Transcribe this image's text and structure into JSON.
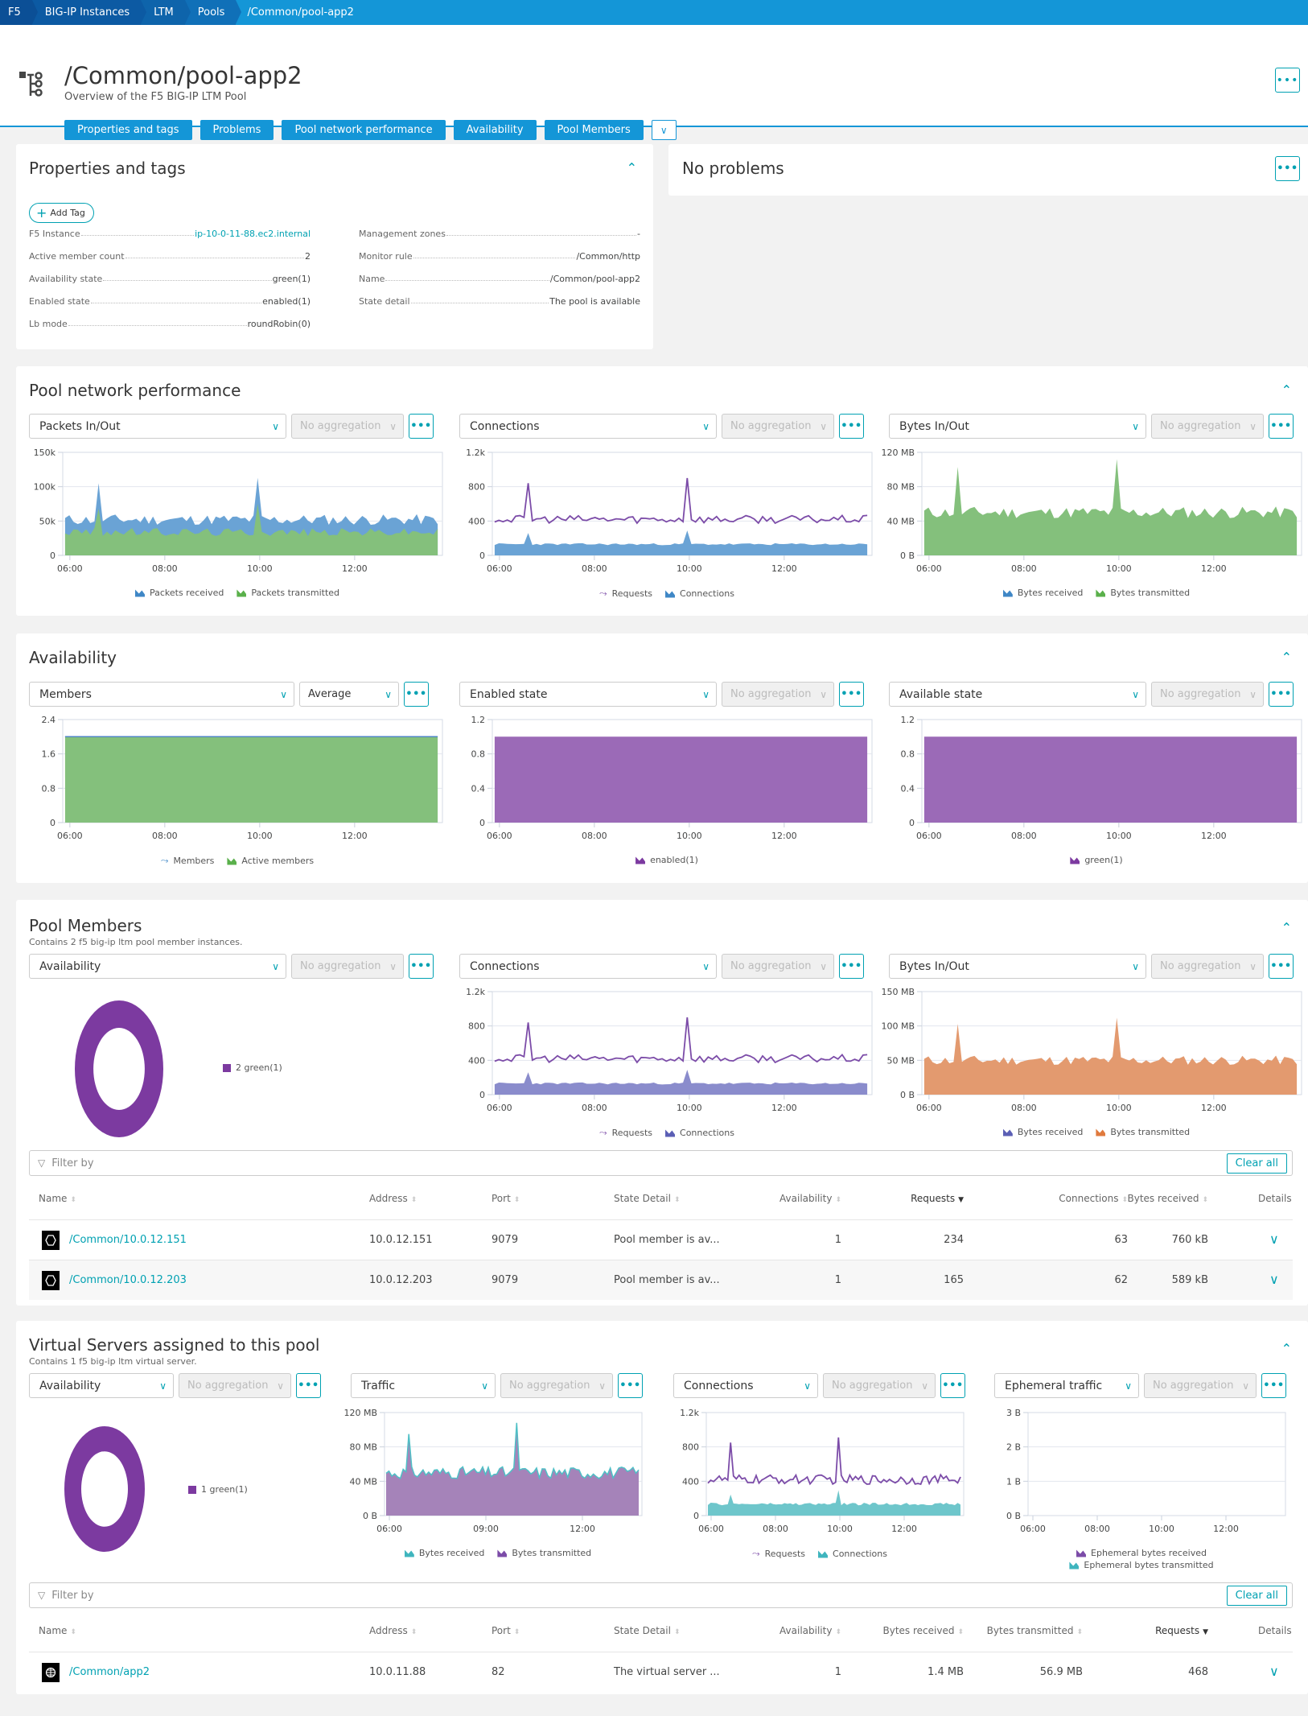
{
  "breadcrumb": [
    "F5",
    "BIG-IP Instances",
    "LTM",
    "Pools",
    "/Common/pool-app2"
  ],
  "header": {
    "title": "/Common/pool-app2",
    "subtitle": "Overview of the F5 BIG-IP LTM Pool",
    "nav": [
      "Properties and tags",
      "Problems",
      "Pool network performance",
      "Availability",
      "Pool Members"
    ],
    "more_icon": "chevron-down-icon",
    "menu_icon": "ellipsis-icon"
  },
  "properties": {
    "title": "Properties and tags",
    "add_tag": "Add Tag",
    "left": [
      {
        "k": "F5 Instance",
        "v": "ip-10-0-11-88.ec2.internal",
        "link": true
      },
      {
        "k": "Active member count",
        "v": "2"
      },
      {
        "k": "Availability state",
        "v": "green(1)"
      },
      {
        "k": "Enabled state",
        "v": "enabled(1)"
      },
      {
        "k": "Lb mode",
        "v": "roundRobin(0)"
      }
    ],
    "right": [
      {
        "k": "Management zones",
        "v": "-"
      },
      {
        "k": "Monitor rule",
        "v": "/Common/http"
      },
      {
        "k": "Name",
        "v": "/Common/pool-app2"
      },
      {
        "k": "State detail",
        "v": "The pool is available"
      }
    ]
  },
  "problems": {
    "title": "No problems"
  },
  "common": {
    "no_aggregation": "No aggregation",
    "filter_placeholder": "Filter by",
    "clear_all": "Clear all"
  },
  "network": {
    "title": "Pool network performance",
    "selects": [
      "Packets In/Out",
      "Connections",
      "Bytes In/Out"
    ]
  },
  "availability": {
    "title": "Availability",
    "selects": [
      "Members",
      "Enabled state",
      "Available state"
    ],
    "agg0": "Average"
  },
  "members": {
    "title": "Pool Members",
    "desc": "Contains 2 f5 big-ip ltm pool member instances.",
    "selects": [
      "Availability",
      "Connections",
      "Bytes In/Out"
    ],
    "donut_legend": "2 green(1)",
    "columns": [
      "Name",
      "Address",
      "Port",
      "State Detail",
      "Availability",
      "Requests",
      "Connections",
      "Bytes received",
      "Details"
    ],
    "sorted_col": "Requests",
    "rows": [
      {
        "name": "/Common/10.0.12.151",
        "address": "10.0.12.151",
        "port": "9079",
        "state": "Pool member is av...",
        "availability": "1",
        "requests": "234",
        "connections": "63",
        "bytes": "760 kB"
      },
      {
        "name": "/Common/10.0.12.203",
        "address": "10.0.12.203",
        "port": "9079",
        "state": "Pool member is av...",
        "availability": "1",
        "requests": "165",
        "connections": "62",
        "bytes": "589 kB"
      }
    ]
  },
  "vservers": {
    "title": "Virtual Servers assigned to this pool",
    "desc": "Contains 1 f5 big-ip ltm virtual server.",
    "selects": [
      "Availability",
      "Traffic",
      "Connections",
      "Ephemeral traffic"
    ],
    "donut_legend": "1 green(1)",
    "columns": [
      "Name",
      "Address",
      "Port",
      "State Detail",
      "Availability",
      "Bytes received",
      "Bytes transmitted",
      "Requests",
      "Details"
    ],
    "sorted_col": "Requests",
    "rows": [
      {
        "name": "/Common/app2",
        "address": "10.0.11.88",
        "port": "82",
        "state": "The virtual server ...",
        "availability": "1",
        "bytes_rx": "1.4 MB",
        "bytes_tx": "56.9 MB",
        "requests": "468"
      }
    ]
  },
  "chart_data": [
    {
      "id": "net-packets",
      "type": "area",
      "yticks": [
        "0",
        "50k",
        "100k",
        "150k"
      ],
      "ylim": [
        0,
        150000
      ],
      "xticks": [
        "06:00",
        "08:00",
        "10:00",
        "12:00"
      ],
      "x_range_hours": [
        5.9,
        13.75
      ],
      "series": [
        {
          "name": "Packets received",
          "color": "#6aa3d5",
          "base": 52000,
          "jitter": 8000,
          "spikes": [
            [
              6.6,
              105000
            ],
            [
              9.95,
              113000
            ]
          ],
          "stack": true
        },
        {
          "name": "Packets transmitted",
          "color": "#84c07c",
          "base": 34000,
          "jitter": 6000,
          "spikes": [
            [
              6.6,
              68000
            ],
            [
              9.95,
              75000
            ]
          ]
        }
      ],
      "legend": [
        {
          "label": "Packets received",
          "color": "#3f87c6",
          "kind": "area"
        },
        {
          "label": "Packets transmitted",
          "color": "#5ab04b",
          "kind": "area"
        }
      ]
    },
    {
      "id": "net-conn",
      "type": "line+area",
      "yticks": [
        "0",
        "400",
        "800",
        "1.2k"
      ],
      "ylim": [
        0,
        1200
      ],
      "xticks": [
        "06:00",
        "08:00",
        "10:00",
        "12:00"
      ],
      "x_range_hours": [
        5.9,
        13.75
      ],
      "series": [
        {
          "name": "Requests",
          "color": "#7c4ca8",
          "kind": "line",
          "base": 420,
          "jitter": 45,
          "spikes": [
            [
              6.6,
              840
            ],
            [
              9.95,
              900
            ]
          ]
        },
        {
          "name": "Connections",
          "color": "#6aa3d5",
          "kind": "area",
          "base": 130,
          "jitter": 12,
          "spikes": [
            [
              6.6,
              260
            ],
            [
              9.95,
              290
            ]
          ]
        }
      ],
      "legend": [
        {
          "label": "Requests",
          "color": "#7c4ca8",
          "kind": "line"
        },
        {
          "label": "Connections",
          "color": "#3f87c6",
          "kind": "area"
        }
      ]
    },
    {
      "id": "net-bytes",
      "type": "area",
      "yticks": [
        "0 B",
        "40 MB",
        "80 MB",
        "120 MB"
      ],
      "ylim": [
        0,
        120
      ],
      "xticks": [
        "06:00",
        "08:00",
        "10:00",
        "12:00"
      ],
      "x_range_hours": [
        5.9,
        13.75
      ],
      "series": [
        {
          "name": "Bytes transmitted",
          "color": "#84c07c",
          "base": 50,
          "jitter": 7,
          "spikes": [
            [
              6.6,
              103
            ],
            [
              9.95,
              112
            ]
          ]
        }
      ],
      "legend": [
        {
          "label": "Bytes received",
          "color": "#3f87c6",
          "kind": "area"
        },
        {
          "label": "Bytes transmitted",
          "color": "#5ab04b",
          "kind": "area"
        }
      ]
    },
    {
      "id": "av-members",
      "type": "area",
      "yticks": [
        "0",
        "0.8",
        "1.6",
        "2.4"
      ],
      "ylim": [
        0,
        2.4
      ],
      "xticks": [
        "06:00",
        "08:00",
        "10:00",
        "12:00"
      ],
      "x_range_hours": [
        5.9,
        13.75
      ],
      "series": [
        {
          "name": "Active members",
          "color": "#84c07c",
          "base": 2,
          "jitter": 0,
          "spikes": [],
          "topline": "#4f86c4"
        }
      ],
      "legend": [
        {
          "label": "Members",
          "color": "#3f87c6",
          "kind": "line"
        },
        {
          "label": "Active members",
          "color": "#5ab04b",
          "kind": "area"
        }
      ]
    },
    {
      "id": "av-enabled",
      "type": "area",
      "yticks": [
        "0",
        "0.4",
        "0.8",
        "1.2"
      ],
      "ylim": [
        0,
        1.2
      ],
      "xticks": [
        "06:00",
        "08:00",
        "10:00",
        "12:00"
      ],
      "x_range_hours": [
        5.9,
        13.75
      ],
      "series": [
        {
          "name": "enabled(1)",
          "color": "#9b6ab7",
          "base": 1,
          "jitter": 0,
          "spikes": []
        }
      ],
      "legend": [
        {
          "label": "enabled(1)",
          "color": "#7c3aa0",
          "kind": "area"
        }
      ]
    },
    {
      "id": "av-available",
      "type": "area",
      "yticks": [
        "0",
        "0.4",
        "0.8",
        "1.2"
      ],
      "ylim": [
        0,
        1.2
      ],
      "xticks": [
        "06:00",
        "08:00",
        "10:00",
        "12:00"
      ],
      "x_range_hours": [
        5.9,
        13.75
      ],
      "series": [
        {
          "name": "green(1)",
          "color": "#9b6ab7",
          "base": 1,
          "jitter": 0,
          "spikes": []
        }
      ],
      "legend": [
        {
          "label": "green(1)",
          "color": "#7c3aa0",
          "kind": "area"
        }
      ]
    },
    {
      "id": "pm-donut",
      "type": "pie",
      "slices": [
        {
          "label": "green(1)",
          "value": 2,
          "color": "#7c3aa0"
        }
      ]
    },
    {
      "id": "pm-conn",
      "type": "line+area",
      "yticks": [
        "0",
        "400",
        "800",
        "1.2k"
      ],
      "ylim": [
        0,
        1200
      ],
      "xticks": [
        "06:00",
        "08:00",
        "10:00",
        "12:00"
      ],
      "x_range_hours": [
        5.9,
        13.75
      ],
      "series": [
        {
          "name": "Requests",
          "color": "#7c4ca8",
          "kind": "line",
          "base": 420,
          "jitter": 45,
          "spikes": [
            [
              6.6,
              840
            ],
            [
              9.95,
              900
            ]
          ]
        },
        {
          "name": "Connections",
          "color": "#8a8ccc",
          "kind": "area",
          "base": 130,
          "jitter": 12,
          "spikes": [
            [
              6.6,
              260
            ],
            [
              9.95,
              290
            ]
          ]
        }
      ],
      "legend": [
        {
          "label": "Requests",
          "color": "#7c4ca8",
          "kind": "line"
        },
        {
          "label": "Connections",
          "color": "#5b5fb5",
          "kind": "area"
        }
      ]
    },
    {
      "id": "pm-bytes",
      "type": "area",
      "yticks": [
        "0 B",
        "50 MB",
        "100 MB",
        "150 MB"
      ],
      "ylim": [
        0,
        150
      ],
      "xticks": [
        "06:00",
        "08:00",
        "10:00",
        "12:00"
      ],
      "x_range_hours": [
        5.9,
        13.75
      ],
      "series": [
        {
          "name": "Bytes transmitted",
          "color": "#e39a6f",
          "base": 50,
          "jitter": 7,
          "spikes": [
            [
              6.6,
              103
            ],
            [
              9.95,
              112
            ]
          ]
        }
      ],
      "legend": [
        {
          "label": "Bytes received",
          "color": "#5b5fb5",
          "kind": "area"
        },
        {
          "label": "Bytes transmitted",
          "color": "#e07a3e",
          "kind": "area"
        }
      ]
    },
    {
      "id": "vs-donut",
      "type": "pie",
      "slices": [
        {
          "label": "green(1)",
          "value": 1,
          "color": "#7c3aa0"
        }
      ]
    },
    {
      "id": "vs-traffic",
      "type": "area",
      "yticks": [
        "0 B",
        "40 MB",
        "80 MB",
        "120 MB"
      ],
      "ylim": [
        0,
        120
      ],
      "xticks": [
        "06:00",
        "09:00",
        "12:00"
      ],
      "xtick_hours": [
        6,
        9,
        12
      ],
      "x_range_hours": [
        5.9,
        13.75
      ],
      "series": [
        {
          "name": "Bytes transmitted",
          "color": "#a583b9",
          "base": 50,
          "jitter": 7,
          "spikes": [
            [
              6.6,
              95
            ],
            [
              9.95,
              108
            ]
          ],
          "topline": "#4fc0c6"
        }
      ],
      "legend": [
        {
          "label": "Bytes received",
          "color": "#3fb5be",
          "kind": "area"
        },
        {
          "label": "Bytes transmitted",
          "color": "#7c4ca8",
          "kind": "area"
        }
      ]
    },
    {
      "id": "vs-conn",
      "type": "line+area",
      "yticks": [
        "0",
        "400",
        "800",
        "1.2k"
      ],
      "ylim": [
        0,
        1200
      ],
      "xticks": [
        "06:00",
        "08:00",
        "10:00",
        "12:00"
      ],
      "x_range_hours": [
        5.9,
        13.75
      ],
      "series": [
        {
          "name": "Requests",
          "color": "#7c4ca8",
          "kind": "line",
          "base": 420,
          "jitter": 55,
          "spikes": [
            [
              6.6,
              850
            ],
            [
              9.95,
              910
            ]
          ]
        },
        {
          "name": "Connections",
          "color": "#6ec6cb",
          "kind": "area",
          "base": 135,
          "jitter": 15,
          "spikes": [
            [
              6.6,
              245
            ],
            [
              9.95,
              295
            ]
          ]
        }
      ],
      "legend": [
        {
          "label": "Requests",
          "color": "#7c4ca8",
          "kind": "line"
        },
        {
          "label": "Connections",
          "color": "#3fb5be",
          "kind": "area"
        }
      ]
    },
    {
      "id": "vs-ephemeral",
      "type": "area",
      "yticks": [
        "0 B",
        "1 B",
        "2 B",
        "3 B"
      ],
      "ylim": [
        0,
        3
      ],
      "xticks": [
        "06:00",
        "08:00",
        "10:00",
        "12:00"
      ],
      "x_range_hours": [
        5.9,
        13.75
      ],
      "series": [],
      "legend": [
        {
          "label": "Ephemeral bytes received",
          "color": "#7c4ca8",
          "kind": "area"
        },
        {
          "label": "Ephemeral bytes transmitted",
          "color": "#3fb5be",
          "kind": "area"
        }
      ],
      "legend_stacked": true
    }
  ]
}
